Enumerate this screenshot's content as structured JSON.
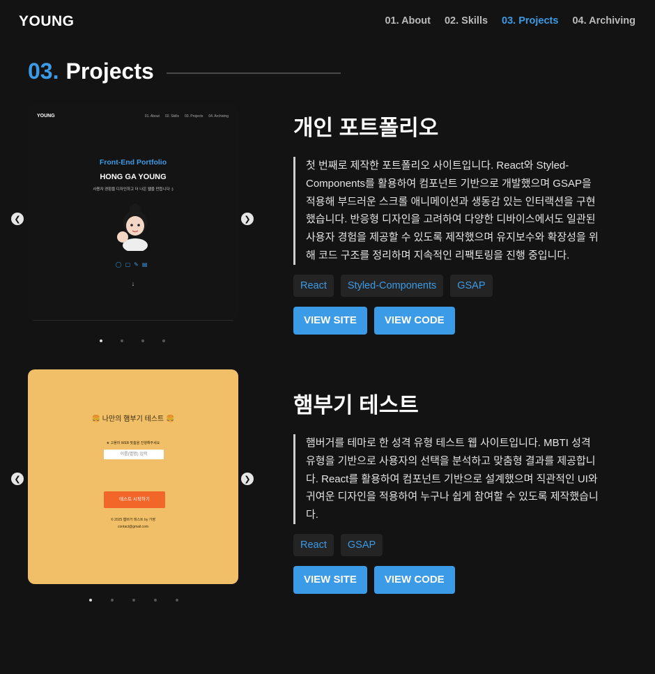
{
  "header": {
    "logo": "YOUNG",
    "nav": [
      "01. About",
      "02. Skills",
      "03. Projects",
      "04. Archiving"
    ]
  },
  "section": {
    "num": "03.",
    "title": "Projects"
  },
  "slider1": {
    "logo": "YOUNG",
    "nav": [
      "01. About",
      "02. Skills",
      "03. Projects",
      "04. Archiving"
    ],
    "subtitle": "Front-End Portfolio",
    "name": "HONG GA YOUNG",
    "desc": "사용자 경험을 디자인하고 더 나은 웹을 만듭니다 :)",
    "down": "↓",
    "icons": [
      "github-icon",
      "blog-icon",
      "pencil-icon",
      "note-icon"
    ]
  },
  "slider2": {
    "title": "🍔 나만의 햄부기 테스트 🍔",
    "hint": "★ 고플러 WEB 맞춤을 진행해주세요",
    "input_placeholder": "이름(별명) 입력",
    "button": "테스트 시작하기",
    "footer1": "© 2025 햄버거 테스트 by 가영",
    "footer2": "contact@gmail.com"
  },
  "projects": [
    {
      "title": "개인 포트폴리오",
      "desc": "첫 번째로 제작한 포트폴리오 사이트입니다. React와 Styled-Components를 활용하여 컴포넌트 기반으로 개발했으며 GSAP을 적용해 부드러운 스크롤 애니메이션과 생동감 있는 인터랙션을 구현했습니다. 반응형 디자인을 고려하여 다양한 디바이스에서도 일관된 사용자 경험을 제공할 수 있도록 제작했으며 유지보수와 확장성을 위해 코드 구조를 정리하며 지속적인 리팩토링을 진행 중입니다.",
      "tags": [
        "React",
        "Styled-Components",
        "GSAP"
      ],
      "view_site": "VIEW SITE",
      "view_code": "VIEW CODE"
    },
    {
      "title": "햄부기 테스트",
      "desc": "햄버거를 테마로 한 성격 유형 테스트 웹 사이트입니다. MBTI 성격 유형을 기반으로 사용자의 선택을 분석하고 맞춤형 결과를 제공합니다. React를 활용하여 컴포넌트 기반으로 설계했으며 직관적인 UI와 귀여운 디자인을 적용하여 누구나 쉽게 참여할 수 있도록 제작했습니다.",
      "tags": [
        "React",
        "GSAP"
      ],
      "view_site": "VIEW SITE",
      "view_code": "VIEW CODE"
    }
  ],
  "colors": {
    "accent": "#3b9be6",
    "background": "#131313",
    "slide2_bg": "#f0bf68",
    "slide2_button": "#f2662a"
  }
}
